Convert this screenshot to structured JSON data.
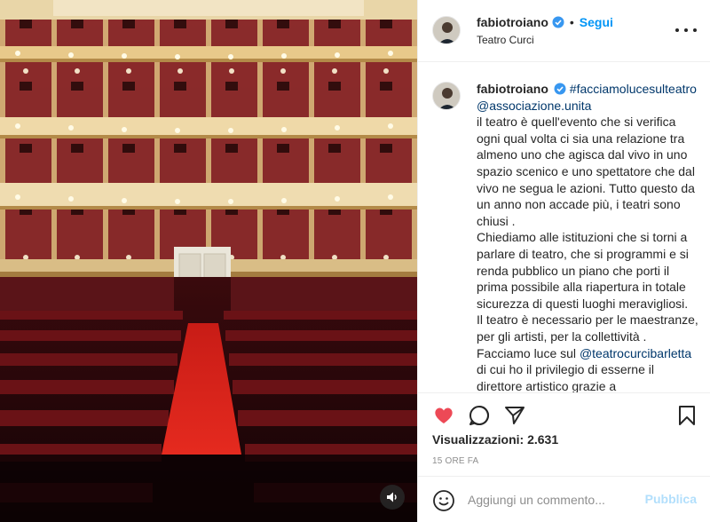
{
  "post": {
    "username": "fabiotroiano",
    "verified": true,
    "follow_label": "Segui",
    "location": "Teatro Curci",
    "caption_hashtag": "#facciamolucesulteatro",
    "caption_mention": "@associazione.unita",
    "caption_p1": "il teatro è quell'evento che si verifica ogni qual volta ci sia una relazione tra almeno uno che agisca dal vivo in uno spazio scenico e uno spettatore che dal vivo ne segua le azioni. Tutto questo da un anno non accade più, i teatri sono chiusi .",
    "caption_p2": "Chiediamo alle istituzioni che si torni a parlare di teatro, che si programmi e si renda pubblico un piano che porti il prima possibile alla riapertura in totale sicurezza di questi luoghi meravigliosi.",
    "caption_p3": "Il teatro è necessario per le maestranze, per gli artisti, per la collettività .",
    "caption_p4_pre": "Facciamo luce sul ",
    "caption_p4_mention": "@teatrocurcibarletta",
    "caption_p4_post": " di cui ho il privilegio di esserne il direttore artistico grazie a"
  },
  "actions": {
    "liked": true,
    "views_label": "Visualizzazioni: 2.631",
    "time_ago": "15 ORE FA"
  },
  "comment": {
    "placeholder": "Aggiungi un commento...",
    "publish_label": "Pubblica"
  },
  "icons": {
    "like": "heart-icon",
    "comment": "comment-icon",
    "share": "paper-plane-icon",
    "save": "bookmark-icon",
    "emoji": "smiley-icon",
    "sound": "speaker-icon",
    "options": "ellipsis-icon",
    "verified": "verified-badge-icon"
  },
  "colors": {
    "accent": "#0095f6",
    "like": "#ed4956",
    "link": "#00376b",
    "seat_red": "#7a1418",
    "carpet": "#d8231c",
    "gold": "#e8c98a"
  }
}
